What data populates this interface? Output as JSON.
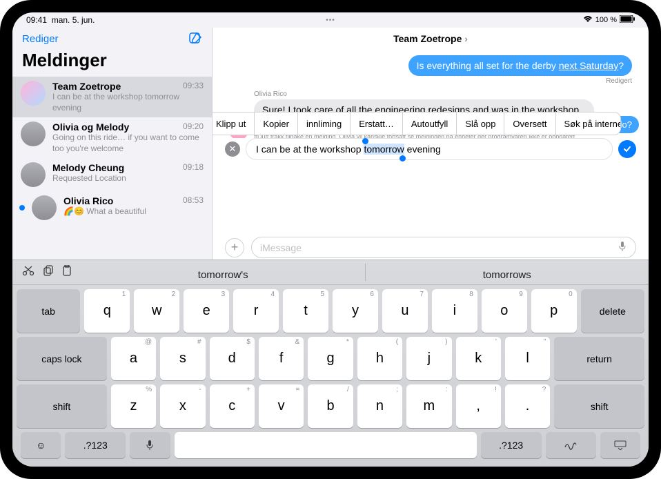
{
  "status": {
    "time": "09:41",
    "date": "man. 5. jun.",
    "battery": "100 %"
  },
  "sidebar": {
    "edit": "Rediger",
    "title": "Meldinger",
    "items": [
      {
        "name": "Team Zoetrope",
        "time": "09:33",
        "preview": "I can be at the workshop tomorrow evening"
      },
      {
        "name": "Olivia og Melody",
        "time": "09:20",
        "preview": "Going on this ride… if you want to come too you're welcome"
      },
      {
        "name": "Melody Cheung",
        "time": "09:18",
        "preview": "Requested Location"
      },
      {
        "name": "Olivia Rico",
        "time": "08:53",
        "preview": "🌈😊 What a beautiful"
      }
    ]
  },
  "chat": {
    "title": "Team Zoetrope",
    "out1_a": "Is everything all set for the derby ",
    "out1_b": "next Saturday",
    "out1_c": "?",
    "out1_status": "Redigert",
    "in1_sender": "Olivia Rico",
    "in1_text": "Sure! I took care of all the engineering redesigns and was in the workshop all weekend making the changes to the car",
    "retract": "#Du# trakk tilbake en melding. Olivia vil kanskje fortsatt se meldingen på enheter der programvaren ikke er oppdatert.",
    "partial": "do?",
    "edit_a": "I can be at the workshop ",
    "edit_sel": "tomorrow",
    "edit_b": " evening",
    "compose_placeholder": "iMessage"
  },
  "context": [
    "Klipp ut",
    "Kopier",
    "innliming",
    "Erstatt…",
    "Autoutfyll",
    "Slå opp",
    "Oversett",
    "Søk på internett"
  ],
  "kb": {
    "sugg1": "tomorrow's",
    "sugg2": "tomorrows",
    "row1": [
      {
        "k": "q",
        "h": "1"
      },
      {
        "k": "w",
        "h": "2"
      },
      {
        "k": "e",
        "h": "3"
      },
      {
        "k": "r",
        "h": "4"
      },
      {
        "k": "t",
        "h": "5"
      },
      {
        "k": "y",
        "h": "6"
      },
      {
        "k": "u",
        "h": "7"
      },
      {
        "k": "i",
        "h": "8"
      },
      {
        "k": "o",
        "h": "9"
      },
      {
        "k": "p",
        "h": "0"
      }
    ],
    "row2": [
      {
        "k": "a",
        "h": "@"
      },
      {
        "k": "s",
        "h": "#"
      },
      {
        "k": "d",
        "h": "$"
      },
      {
        "k": "f",
        "h": "&"
      },
      {
        "k": "g",
        "h": "*"
      },
      {
        "k": "h",
        "h": "("
      },
      {
        "k": "j",
        "h": ")"
      },
      {
        "k": "k",
        "h": "'"
      },
      {
        "k": "l",
        "h": "\""
      }
    ],
    "row3": [
      {
        "k": "z",
        "h": "%"
      },
      {
        "k": "x",
        "h": "-"
      },
      {
        "k": "c",
        "h": "+"
      },
      {
        "k": "v",
        "h": "="
      },
      {
        "k": "b",
        "h": "/"
      },
      {
        "k": "n",
        "h": ";"
      },
      {
        "k": "m",
        "h": ":"
      },
      {
        "k": ",",
        "h": "!"
      },
      {
        "k": ".",
        "h": "?"
      }
    ],
    "tab": "tab",
    "delete": "delete",
    "caps": "caps lock",
    "return": "return",
    "shift": "shift",
    "numkey": ".?123"
  }
}
